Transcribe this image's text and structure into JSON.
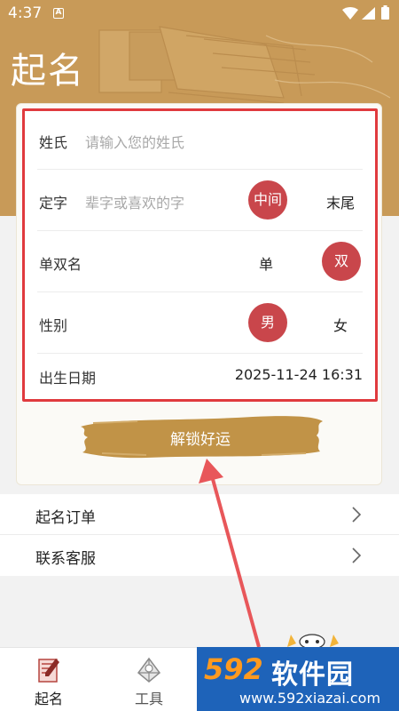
{
  "status_bar": {
    "time": "4:37",
    "badge": "A"
  },
  "header": {
    "title": "起名"
  },
  "form": {
    "surname": {
      "label": "姓氏",
      "placeholder": "请输入您的姓氏"
    },
    "fixed_char": {
      "label": "定字",
      "placeholder": "辈字或喜欢的字",
      "option_middle": "中间",
      "option_end": "末尾",
      "selected": "中间"
    },
    "name_length": {
      "label": "单双名",
      "option_single": "单",
      "option_double": "双",
      "selected": "双"
    },
    "gender": {
      "label": "性别",
      "option_male": "男",
      "option_female": "女",
      "selected": "男"
    },
    "birth": {
      "label": "出生日期",
      "value": "2025-11-24 16:31"
    }
  },
  "unlock_button": {
    "label": "解锁好运"
  },
  "menu": {
    "items": [
      {
        "label": "起名订单"
      },
      {
        "label": "联系客服"
      }
    ]
  },
  "tabbar": {
    "tabs": [
      {
        "label": "起名",
        "active": true
      },
      {
        "label": "工具",
        "active": false
      }
    ]
  },
  "watermark": {
    "number": "592",
    "brand": "软件园",
    "url": "www.592xiazai.com"
  },
  "colors": {
    "header_gold": "#c89a58",
    "pill_red": "#c9464b",
    "highlight_red": "#e03a3e",
    "arrow_red": "#e8575a",
    "watermark_blue": "#1e63b9",
    "watermark_orange": "#ff9a1f"
  }
}
